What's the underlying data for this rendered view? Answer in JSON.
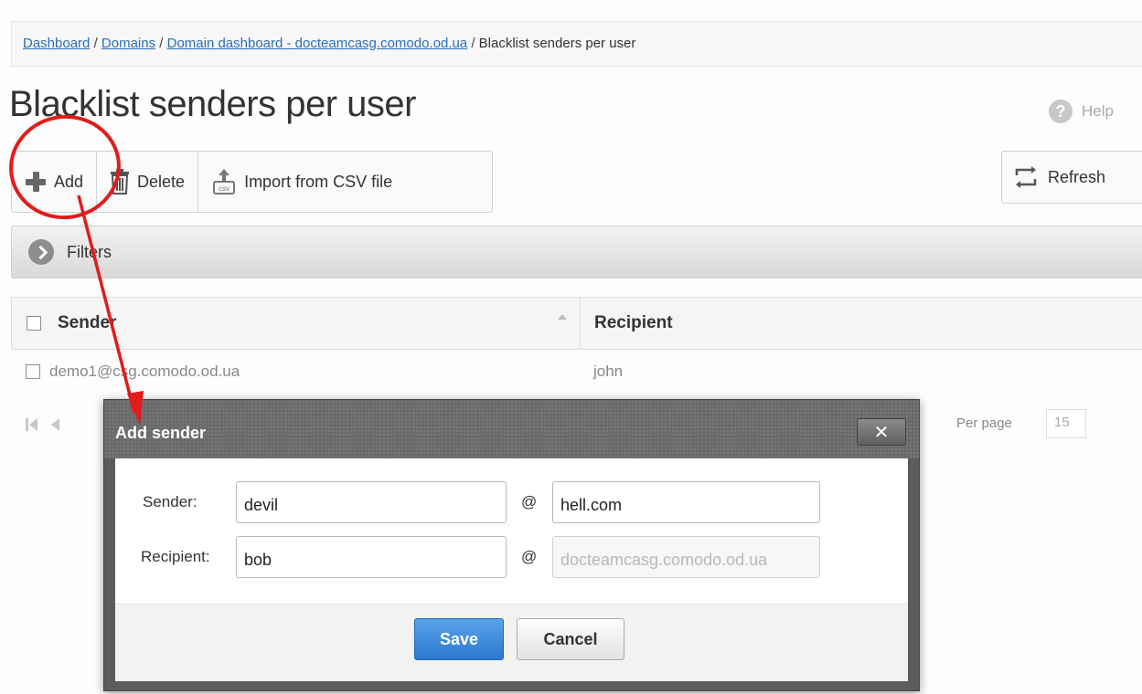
{
  "breadcrumb": {
    "items": [
      "Dashboard",
      "Domains",
      "Domain dashboard - docteamcasg.comodo.od.ua"
    ],
    "current": "Blacklist senders per user",
    "separator": "/"
  },
  "page": {
    "title": "Blacklist senders per user",
    "help_label": "Help"
  },
  "toolbar": {
    "add_label": "Add",
    "delete_label": "Delete",
    "import_label": "Import from CSV file",
    "refresh_label": "Refresh"
  },
  "filters": {
    "label": "Filters"
  },
  "table": {
    "columns": [
      "Sender",
      "Recipient"
    ],
    "rows": [
      {
        "sender": "demo1@csg.comodo.od.ua",
        "recipient": "john"
      }
    ]
  },
  "pager": {
    "per_page_label": "Per page",
    "per_page_value": "15"
  },
  "modal": {
    "title": "Add sender",
    "close_glyph": "✕",
    "sender_label": "Sender:",
    "recipient_label": "Recipient:",
    "at_symbol": "@",
    "sender_local": "devil",
    "sender_domain": "hell.com",
    "recipient_local": "bob",
    "recipient_domain": "docteamcasg.comodo.od.ua",
    "save_label": "Save",
    "cancel_label": "Cancel"
  },
  "colors": {
    "link": "#2a6eb5",
    "primary_button": "#2b78d0",
    "annotation": "#e21b1b",
    "modal_frame": "#5c5c5c"
  },
  "icons": [
    "plus-icon",
    "trash-icon",
    "csv-icon",
    "refresh-icon",
    "help-icon",
    "chevron-circle-icon",
    "sort-icon",
    "close-icon",
    "pager-first-icon",
    "pager-prev-icon"
  ]
}
